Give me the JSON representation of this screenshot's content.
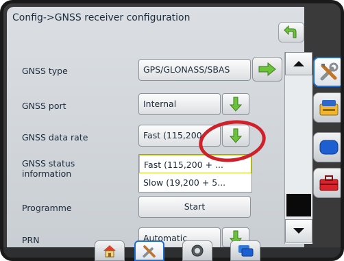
{
  "header": {
    "title": "Config->GNSS receiver configuration"
  },
  "rows": [
    {
      "label": "GNSS type",
      "value": "GPS/GLONASS/SBAS"
    },
    {
      "label": "GNSS port",
      "value": "Internal"
    },
    {
      "label": "GNSS data rate",
      "value": "Fast (115,200"
    },
    {
      "label": "GNSS status information",
      "value": ""
    },
    {
      "label": "Programme",
      "value": "Start"
    },
    {
      "label": "PRN",
      "value": "Automatic"
    }
  ],
  "dropdown": {
    "options": [
      "Fast (115,200 + ...",
      "Slow (19,200 + 5..."
    ]
  },
  "icons": {
    "back": "back-arrow-icon",
    "next": "right-arrow-icon",
    "down": "down-arrow-icon",
    "scroll_up": "triangle-up-icon",
    "scroll_down": "triangle-down-icon",
    "side": [
      "tools-icon",
      "console-icon",
      "display-icon",
      "toolbox-icon"
    ],
    "tabs": [
      "home-icon",
      "tools-icon",
      "gauge-icon",
      "screens-icon"
    ]
  },
  "colors": {
    "accent_green": "#6cc23a",
    "highlight_circle": "#d0202a",
    "active_border": "#1d6fd6"
  }
}
